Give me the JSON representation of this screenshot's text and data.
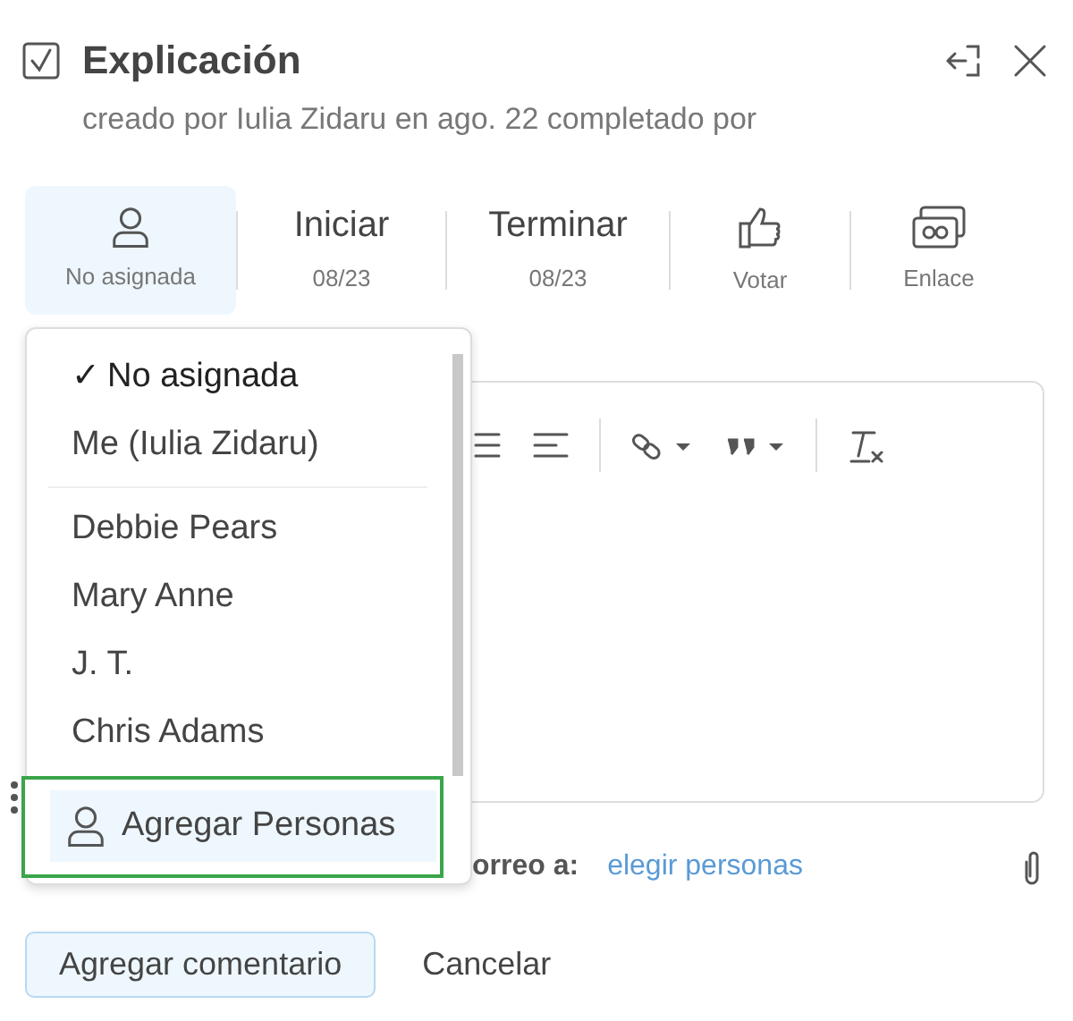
{
  "header": {
    "title": "Explicación",
    "checked": true,
    "subtitle": "creado por Iulia Zidaru en ago. 22 completado por"
  },
  "actions": [
    {
      "kind": "assignee",
      "label": "No asignada",
      "selected": true
    },
    {
      "kind": "date",
      "label": "Iniciar",
      "value": "08/23",
      "selected": false
    },
    {
      "kind": "date",
      "label": "Terminar",
      "value": "08/23",
      "selected": false
    },
    {
      "kind": "vote",
      "label": "Votar",
      "selected": false
    },
    {
      "kind": "link",
      "label": "Enlace",
      "selected": false
    }
  ],
  "email": {
    "label": "orreo a:",
    "link": "elegir personas"
  },
  "buttons": [
    {
      "kind": "primary",
      "label": "Agregar comentario"
    },
    {
      "kind": "plain",
      "label": "Cancelar"
    }
  ],
  "dropdown": {
    "check_mark": "✓",
    "groups": [
      {
        "items": [
          {
            "label": "No asignada",
            "selected": true
          },
          {
            "label": "Me (Iulia Zidaru)",
            "selected": false
          }
        ]
      },
      {
        "items": [
          {
            "label": "Debbie Pears",
            "selected": false
          },
          {
            "label": "Mary Anne",
            "selected": false
          },
          {
            "label": "J. T.",
            "selected": false
          },
          {
            "label": "Chris Adams",
            "selected": false
          }
        ]
      }
    ],
    "action": {
      "label": "Agregar Personas",
      "focused": true
    }
  }
}
